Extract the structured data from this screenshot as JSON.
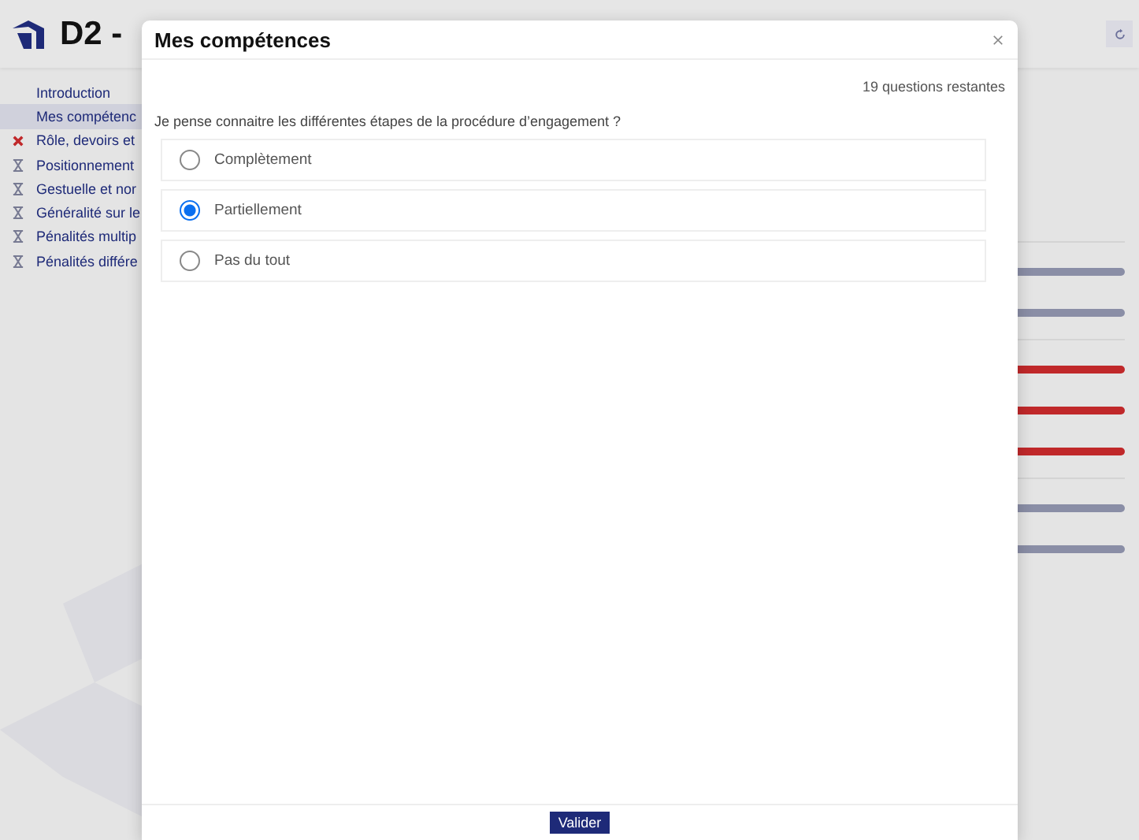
{
  "header": {
    "title": "D2 -"
  },
  "sidebar": {
    "items": [
      {
        "label": "Introduction",
        "kind": "plain",
        "selected": false
      },
      {
        "label": "Mes compétenc",
        "kind": "plain",
        "selected": true
      },
      {
        "label": "Rôle, devoirs et",
        "kind": "failed",
        "selected": false
      },
      {
        "label": "Positionnement",
        "kind": "pending",
        "selected": false
      },
      {
        "label": "Gestuelle et nor",
        "kind": "pending",
        "selected": false
      },
      {
        "label": "Généralité sur le",
        "kind": "pending",
        "selected": false
      },
      {
        "label": "Pénalités multip",
        "kind": "pending",
        "selected": false
      },
      {
        "label": "Pénalités différe",
        "kind": "pending",
        "selected": false
      }
    ]
  },
  "right_panel": {
    "groups": [
      {
        "bars": [
          {
            "color": "#8a8ea6"
          },
          {
            "color": "#8a8ea6"
          }
        ]
      },
      {
        "bars": [
          {
            "color": "#c0282a"
          },
          {
            "color": "#c0282a"
          },
          {
            "color": "#c0282a"
          }
        ]
      },
      {
        "bars": [
          {
            "color": "#8a8ea6"
          },
          {
            "color": "#8a8ea6"
          }
        ]
      }
    ]
  },
  "dialog": {
    "title": "Mes compétences",
    "remaining": "19 questions restantes",
    "question": "Je pense connaitre les différentes étapes de la procédure d’engagement  ?",
    "options": [
      {
        "label": "Complètement",
        "selected": false
      },
      {
        "label": "Partiellement",
        "selected": true
      },
      {
        "label": "Pas du tout",
        "selected": false
      }
    ],
    "submit": "Valider"
  }
}
